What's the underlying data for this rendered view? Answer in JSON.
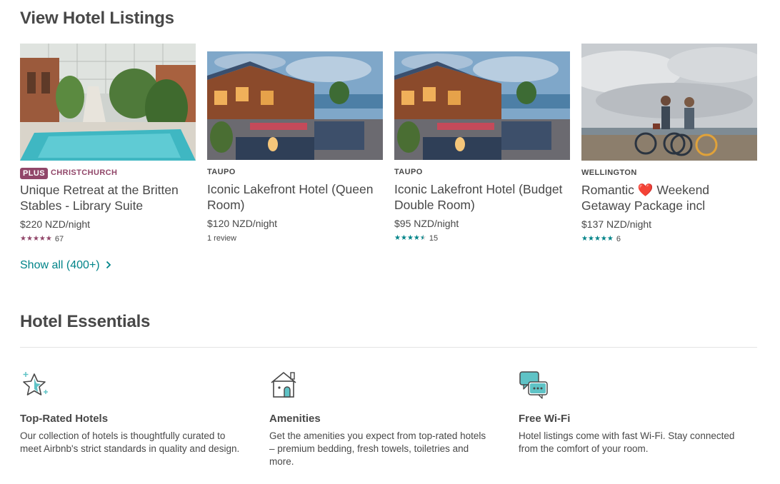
{
  "listings_section": {
    "title": "View Hotel Listings",
    "show_all": "Show all (400+)",
    "cards": [
      {
        "badge": "PLUS",
        "location": "CHRISTCHURCH",
        "location_color": "#914669",
        "name": "Unique Retreat at the Britten Stables - Library Suite",
        "price": "$220 NZD/night",
        "stars": 5,
        "star_color": "#914669",
        "reviews": "67",
        "photo_icon": "pool-courtyard-photo"
      },
      {
        "badge": "",
        "location": "TAUPO",
        "location_color": "#484848",
        "name": "Iconic Lakefront Hotel (Queen Room)",
        "price": "$120 NZD/night",
        "stars": 0,
        "star_color": "#008489",
        "reviews": "1 review",
        "photo_icon": "lakefront-deck-photo"
      },
      {
        "badge": "",
        "location": "TAUPO",
        "location_color": "#484848",
        "name": "Iconic Lakefront Hotel (Budget Double Room)",
        "price": "$95 NZD/night",
        "stars": 4.5,
        "star_color": "#008489",
        "reviews": "15",
        "photo_icon": "lakefront-deck-photo"
      },
      {
        "badge": "",
        "location": "WELLINGTON",
        "location_color": "#484848",
        "name": "Romantic ❤️ Weekend Getaway Package incl",
        "price": "$137 NZD/night",
        "stars": 5,
        "star_color": "#008489",
        "reviews": "6",
        "photo_icon": "couple-bicycles-photo"
      }
    ]
  },
  "essentials_section": {
    "title": "Hotel Essentials",
    "features": [
      {
        "icon": "star-sparkle-icon",
        "title": "Top-Rated Hotels",
        "description": "Our collection of hotels is thoughtfully curated to meet Airbnb's strict standards in quality and design."
      },
      {
        "icon": "house-door-icon",
        "title": "Amenities",
        "description": "Get the amenities you expect from top-rated hotels – premium bedding, fresh towels, toiletries and more."
      },
      {
        "icon": "chat-bubbles-icon",
        "title": "Free Wi-Fi",
        "description": "Hotel listings come with fast Wi-Fi. Stay connected from the comfort of your room."
      }
    ]
  },
  "colors": {
    "accent_teal": "#008489",
    "plus_purple": "#914669",
    "text": "#484848"
  }
}
